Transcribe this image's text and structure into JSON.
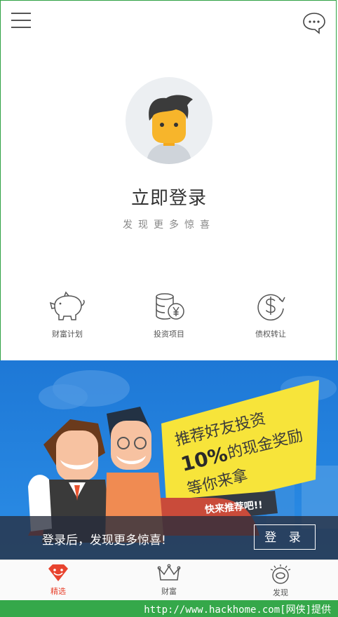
{
  "profile": {
    "login_title": "立即登录",
    "login_subtitle": "发现更多惊喜"
  },
  "quick_nav": [
    {
      "label": "财富计划",
      "icon": "piggy-bank-icon"
    },
    {
      "label": "投资项目",
      "icon": "coins-yen-icon"
    },
    {
      "label": "债权转让",
      "icon": "dollar-transfer-icon"
    }
  ],
  "banner": {
    "promo_line1": "推荐好友投资",
    "promo_line2_num": "10%",
    "promo_line2_text": "的现金奖励",
    "promo_line3": "等你来拿",
    "promo_tag": "快来推荐吧!!",
    "login_prompt": "登录后，发现更多惊喜!",
    "login_button": "登 录"
  },
  "tabs": [
    {
      "label": "精选",
      "icon": "diamond-icon",
      "active": true
    },
    {
      "label": "财富",
      "icon": "crown-icon",
      "active": false
    },
    {
      "label": "发现",
      "icon": "eye-icon",
      "active": false
    }
  ],
  "footer": {
    "watermark": "http://www.hackhome.com[网侠]提供"
  },
  "colors": {
    "accent": "#e8442f",
    "banner_blue": "#1e78d6",
    "promo_yellow": "#f7e43a",
    "footer_green": "#35a84a"
  }
}
